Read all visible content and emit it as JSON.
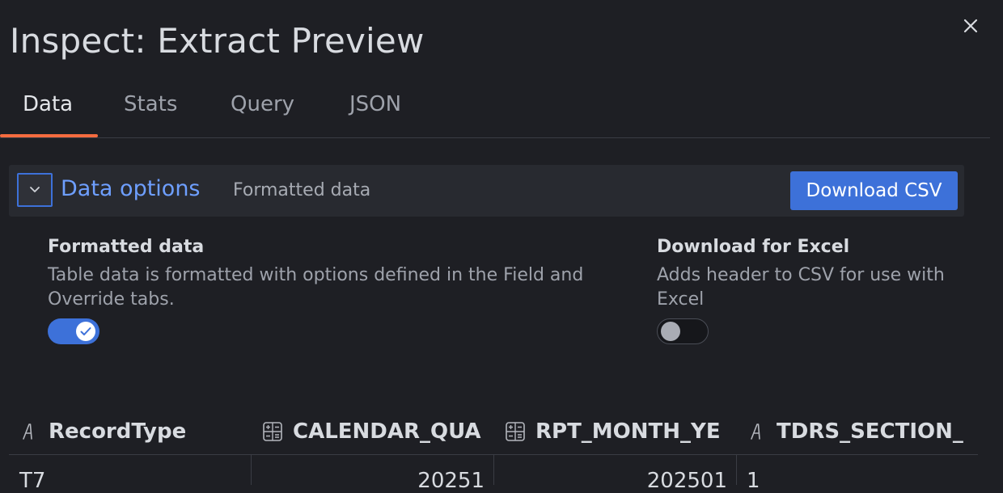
{
  "drawer": {
    "title": "Inspect: Extract Preview",
    "close_icon": "close-icon"
  },
  "tabs": [
    {
      "label": "Data",
      "active": true
    },
    {
      "label": "Stats",
      "active": false
    },
    {
      "label": "Query",
      "active": false
    },
    {
      "label": "JSON",
      "active": false
    }
  ],
  "data_options": {
    "label": "Data options",
    "summary": "Formatted data",
    "download_button": "Download CSV",
    "formatted": {
      "title": "Formatted data",
      "description": "Table data is formatted with options defined in the Field and Override tabs.",
      "enabled": true
    },
    "excel": {
      "title": "Download for Excel",
      "description": "Adds header to CSV for use with Excel",
      "enabled": false
    }
  },
  "table": {
    "columns": [
      {
        "label": "RecordType",
        "icon": "text-type-icon"
      },
      {
        "label": "CALENDAR_QUA",
        "icon": "number-type-icon"
      },
      {
        "label": "RPT_MONTH_YE",
        "icon": "number-type-icon"
      },
      {
        "label": "TDRS_SECTION_",
        "icon": "text-type-icon"
      }
    ],
    "first_row": [
      "T7",
      "20251",
      "202501",
      "1"
    ]
  },
  "colors": {
    "accent": "#3d71d9",
    "link": "#6e9fff",
    "tab_indicator": "#f56b3f",
    "background": "#1e1f24"
  }
}
